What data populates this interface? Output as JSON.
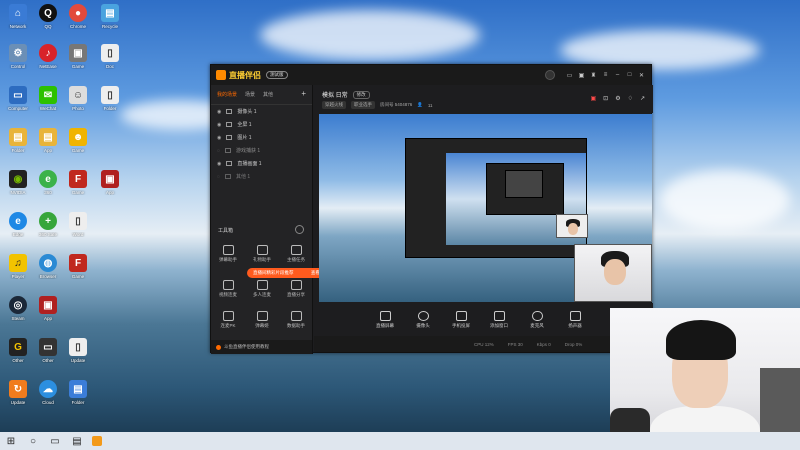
{
  "desktop": {
    "icons": [
      "Network",
      "QQ",
      "Chrome",
      "Recycle",
      "Control",
      "NetEase",
      "Game",
      "Doc",
      "Computer",
      "WeChat",
      "Photo",
      "Folder",
      "Folder",
      "App",
      "Game",
      "Game",
      "NVIDIA",
      "360",
      "Game",
      "App",
      "Edge",
      "360 Safe",
      "Word",
      "Other",
      "Player",
      "Browser",
      "Game",
      "Other",
      "Steam",
      "App",
      "Other",
      "Other",
      "Update",
      "Cloud",
      "Folder",
      "Folder"
    ]
  },
  "window": {
    "logo_text": "直播伴侣",
    "version_badge": "测试版",
    "tabs": [
      "我的场景",
      "场景",
      "其他"
    ],
    "sources": [
      "摄像头 1",
      "全屏 1",
      "图片 1",
      "游戏捕获 1",
      "直播画面 1",
      "其他 1"
    ],
    "tools_title": "工具箱",
    "tools": [
      "弹幕助手",
      "礼物助手",
      "主播任务",
      "视频连麦",
      "多人连麦",
      "直播分享",
      "连麦PK",
      "弹幕姬",
      "数据助手",
      "其他工具",
      "更多工具",
      "设置"
    ],
    "banner_text": "直播间精彩片段推荐",
    "banner_action": "查看",
    "footer_text": "斗鱼直播伴侣使用教程",
    "room_title": "模拟 日常",
    "edit_label": "修改",
    "meta_tag1": "穿越火线",
    "meta_tag2": "职业选手",
    "meta_id": "房间号 5404876",
    "meta_count": "11",
    "controls": [
      "直播屏幕",
      "摄像头",
      "手机投屏",
      "添加窗口",
      "麦克风",
      "扬声器"
    ],
    "status": [
      "CPU 12%",
      "FPS 30",
      "Kbps 0",
      "Drop 0%"
    ]
  },
  "taskbar": {
    "search_icon": "search-icon",
    "items": [
      "windows-icon",
      "search-icon",
      "task-view-icon",
      "file-explorer-icon",
      "app-icon"
    ]
  }
}
